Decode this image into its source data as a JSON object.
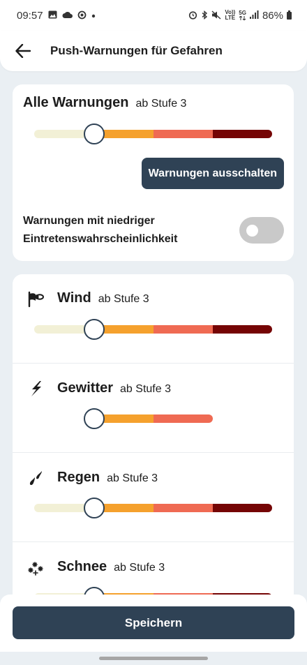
{
  "status_bar": {
    "time": "09:57",
    "network_top": "Vo))",
    "network_bottom": "LTE",
    "fiveg": "5G",
    "battery": "86%"
  },
  "header": {
    "title": "Push-Warnungen für Gefahren"
  },
  "all_warnings": {
    "title": "Alle Warnungen",
    "level_text": "ab Stufe 3",
    "level": 2,
    "off_button": "Warnungen ausschalten",
    "low_prob_label": "Warnungen mit niedriger Eintretenswahrscheinlichkeit",
    "low_prob_enabled": false
  },
  "hazards": [
    {
      "name": "Wind",
      "level_text": "ab Stufe 3",
      "icon": "windsock-icon"
    },
    {
      "name": "Gewitter",
      "level_text": "ab Stufe 3",
      "icon": "lightning-icon"
    },
    {
      "name": "Regen",
      "level_text": "ab Stufe 3",
      "icon": "rain-icon"
    },
    {
      "name": "Schnee",
      "level_text": "ab Stufe 3",
      "icon": "snow-icon"
    }
  ],
  "colors": {
    "level1": "#f2f0d6",
    "level2": "#f5a12d",
    "level3": "#ef6a53",
    "level4": "#750505",
    "primary": "#2f4255"
  },
  "save_button": "Speichern"
}
